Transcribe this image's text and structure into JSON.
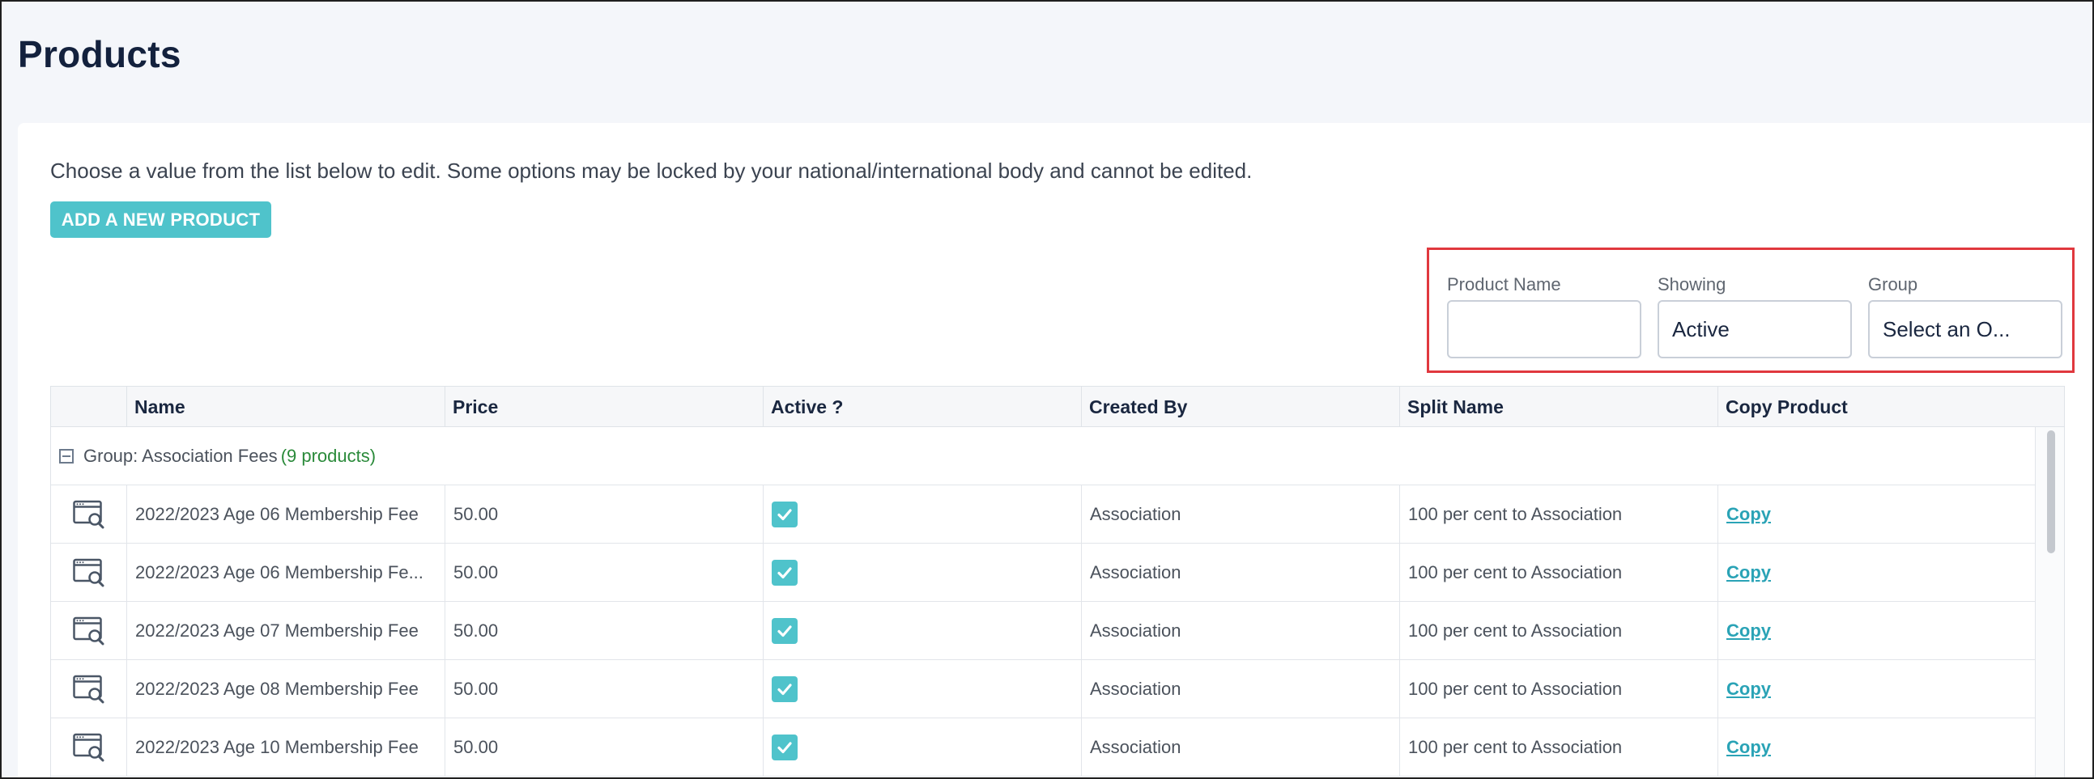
{
  "page": {
    "title": "Products",
    "intro": "Choose a value from the list below to edit. Some options may be locked by your national/international body and cannot be edited.",
    "add_button": "ADD A NEW PRODUCT"
  },
  "filters": {
    "product_name": {
      "label": "Product Name",
      "value": "",
      "placeholder": ""
    },
    "showing": {
      "label": "Showing",
      "value": "Active"
    },
    "group": {
      "label": "Group",
      "value": "Select an O..."
    }
  },
  "table": {
    "columns": [
      "",
      "Name",
      "Price",
      "Active ?",
      "Created By",
      "Split Name",
      "Copy Product"
    ],
    "group": {
      "label": "Group: Association Fees",
      "count": "(9 products)"
    },
    "rows": [
      {
        "name": "2022/2023 Age 06 Membership Fee",
        "price": "50.00",
        "active": true,
        "created_by": "Association",
        "split_name": "100 per cent to Association",
        "copy": "Copy"
      },
      {
        "name": "2022/2023 Age 06 Membership Fe...",
        "price": "50.00",
        "active": true,
        "created_by": "Association",
        "split_name": "100 per cent to Association",
        "copy": "Copy"
      },
      {
        "name": "2022/2023 Age 07 Membership Fee",
        "price": "50.00",
        "active": true,
        "created_by": "Association",
        "split_name": "100 per cent to Association",
        "copy": "Copy"
      },
      {
        "name": "2022/2023 Age 08 Membership Fee",
        "price": "50.00",
        "active": true,
        "created_by": "Association",
        "split_name": "100 per cent to Association",
        "copy": "Copy"
      },
      {
        "name": "2022/2023 Age 10 Membership Fee",
        "price": "50.00",
        "active": true,
        "created_by": "Association",
        "split_name": "100 per cent to Association",
        "copy": "Copy"
      }
    ]
  },
  "colors": {
    "accent": "#4fc3cb",
    "highlight_border": "#e0383e",
    "link": "#2aa3b6",
    "count_green": "#2a8a3a"
  },
  "icons": {
    "row_action": "view-record-icon",
    "checkbox": "checkmark-icon",
    "group_toggle": "collapse-icon"
  }
}
